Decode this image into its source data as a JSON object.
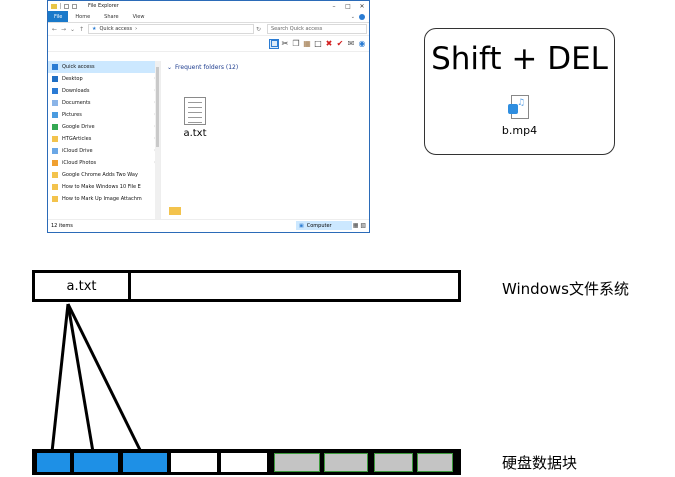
{
  "explorer": {
    "title": "File Explorer",
    "ribbon_tabs": [
      "File",
      "Home",
      "Share",
      "View"
    ],
    "address": "Quick access",
    "search_placeholder": "Search Quick access",
    "nav_items": [
      {
        "label": "Quick access",
        "icon": "star-icon",
        "color": "#2b7cd3",
        "selected": true
      },
      {
        "label": "Desktop",
        "icon": "desktop-icon",
        "color": "#1f6fc5",
        "pinned": true
      },
      {
        "label": "Downloads",
        "icon": "download-icon",
        "color": "#2a7bd5",
        "pinned": true
      },
      {
        "label": "Documents",
        "icon": "documents-icon",
        "color": "#8ab4e8",
        "pinned": true
      },
      {
        "label": "Pictures",
        "icon": "pictures-icon",
        "color": "#4a9be0",
        "pinned": true
      },
      {
        "label": "Google Drive",
        "icon": "google-drive-icon",
        "color": "#34a853",
        "pinned": true
      },
      {
        "label": "HTGArticles",
        "icon": "folder-icon",
        "color": "#f3c34d",
        "pinned": true
      },
      {
        "label": "iCloud Drive",
        "icon": "icloud-icon",
        "color": "#6aa7e6",
        "pinned": true
      },
      {
        "label": "iCloud Photos",
        "icon": "icloud-photos-icon",
        "color": "#f0a030",
        "pinned": true
      },
      {
        "label": "Google Chrome Adds Two Way",
        "icon": "folder-icon",
        "color": "#f3c34d"
      },
      {
        "label": "How to Make Windows 10 File E",
        "icon": "folder-icon",
        "color": "#f3c34d"
      },
      {
        "label": "How to Mark Up Image Attachm",
        "icon": "folder-icon",
        "color": "#f3c34d"
      }
    ],
    "group_header": "Frequent folders (12)",
    "file_name": "a.txt",
    "status_items": "12 items",
    "status_location": "Computer"
  },
  "panel": {
    "title": "Shift + DEL",
    "file_label": "b.mp4"
  },
  "filesystem": {
    "entry": "a.txt",
    "label": "Windows文件系统"
  },
  "disk": {
    "label": "硬盘数据块",
    "blocks": [
      "used",
      "used",
      "used",
      "free",
      "free",
      "gray",
      "gray",
      "gray",
      "gray"
    ]
  }
}
